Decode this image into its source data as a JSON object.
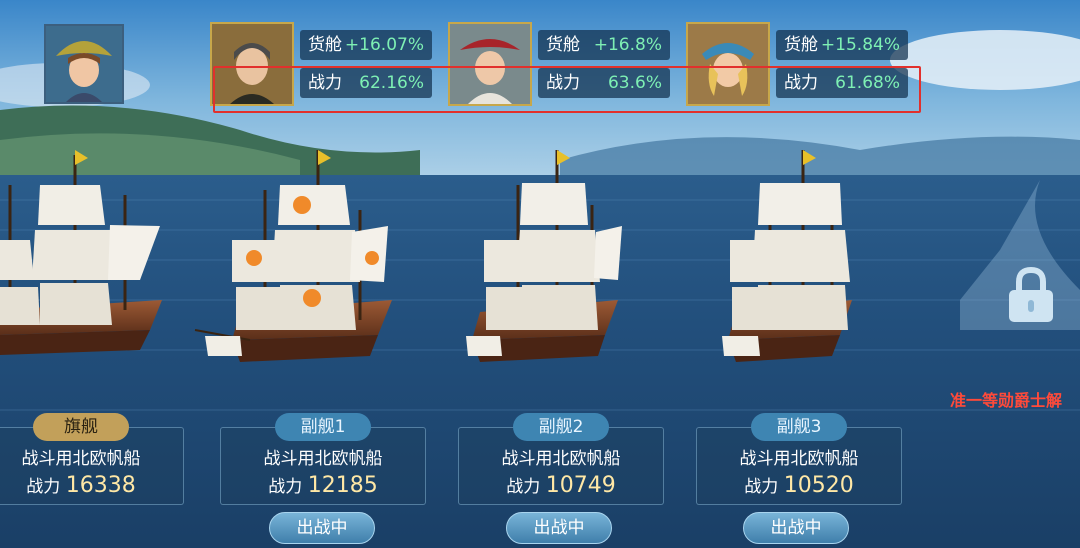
{
  "captain": {
    "portrait": "captain-portrait-icon"
  },
  "officers": [
    {
      "cargo_label": "货舱",
      "cargo_value": "+16.07%",
      "power_label": "战力",
      "power_value": "62.16%"
    },
    {
      "cargo_label": "货舱",
      "cargo_value": "+16.8%",
      "power_label": "战力",
      "power_value": "63.6%"
    },
    {
      "cargo_label": "货舱",
      "cargo_value": "+15.84%",
      "power_label": "战力",
      "power_value": "61.68%"
    }
  ],
  "ships": [
    {
      "badge": "旗舰",
      "name": "战斗用北欧帆船",
      "power_label": "战力",
      "power_value": "16338"
    },
    {
      "badge": "副舰1",
      "name": "战斗用北欧帆船",
      "power_label": "战力",
      "power_value": "12185",
      "button": "出战中"
    },
    {
      "badge": "副舰2",
      "name": "战斗用北欧帆船",
      "power_label": "战力",
      "power_value": "10749",
      "button": "出战中"
    },
    {
      "badge": "副舰3",
      "name": "战斗用北欧帆船",
      "power_label": "战力",
      "power_value": "10520",
      "button": "出战中"
    }
  ],
  "locked_slot": {
    "text": "准一等勋爵士解",
    "icon": "padlock-icon"
  },
  "colors": {
    "highlight": "#e2302c",
    "stat_value": "#7ef0b4",
    "flag_badge": "#c2a05a",
    "sub_badge": "#3e85b2",
    "unlock_text": "#ff4a3a"
  }
}
